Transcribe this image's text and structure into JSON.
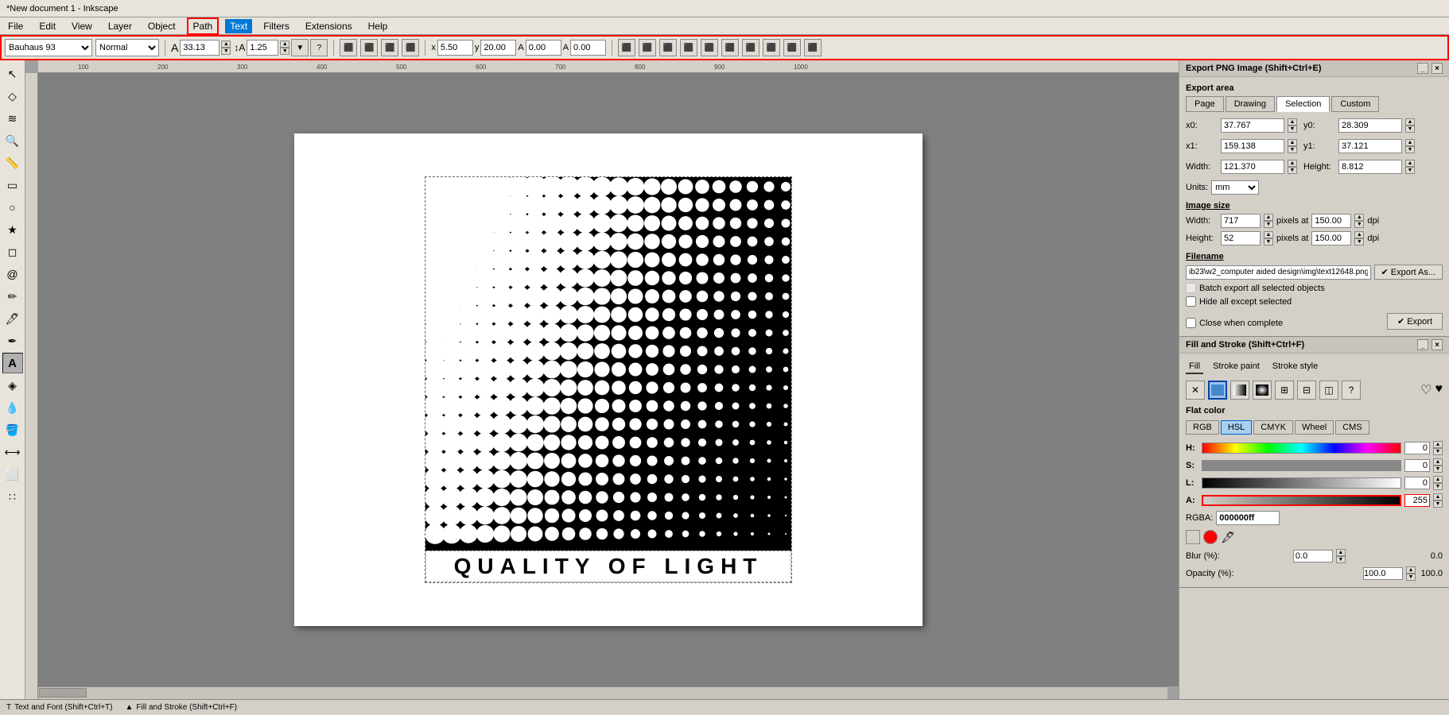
{
  "titlebar": {
    "title": "*New document 1 - Inkscape"
  },
  "menubar": {
    "items": [
      {
        "label": "File",
        "id": "file"
      },
      {
        "label": "Edit",
        "id": "edit"
      },
      {
        "label": "View",
        "id": "view"
      },
      {
        "label": "Layer",
        "id": "layer"
      },
      {
        "label": "Object",
        "id": "object"
      },
      {
        "label": "Path",
        "id": "path",
        "highlighted": true
      },
      {
        "label": "Text",
        "id": "text",
        "active": true
      },
      {
        "label": "Filters",
        "id": "filters"
      },
      {
        "label": "Extensions",
        "id": "extensions"
      },
      {
        "label": "Help",
        "id": "help"
      }
    ]
  },
  "toolbar": {
    "font": "Bauhaus 93",
    "style": "Normal",
    "size": "33.13",
    "height_icon": "A",
    "line_height": "1.25",
    "x": "5.50",
    "y": "20.00",
    "a": "0.00",
    "a2": "0.00",
    "normal_label": "Normal"
  },
  "export_panel": {
    "title": "Export PNG Image (Shift+Ctrl+E)",
    "area_label": "Export area",
    "tabs": [
      "Page",
      "Drawing",
      "Selection",
      "Custom"
    ],
    "active_tab": "Selection",
    "x0_label": "x0:",
    "x0_value": "37.767",
    "y0_label": "y0:",
    "y0_value": "28.309",
    "x1_label": "x1:",
    "x1_value": "159.138",
    "y1_label": "y1:",
    "y1_value": "37.121",
    "width_label": "Width:",
    "width_value": "121.370",
    "height_label": "Height:",
    "height_value": "8.812",
    "units_label": "Units:",
    "units_value": "mm",
    "image_size_title": "Image size",
    "img_width_label": "Width:",
    "img_width_value": "717",
    "pixels_at_label1": "pixels at",
    "dpi_value1": "150.00",
    "dpi_label1": "dpi",
    "img_height_label": "Height:",
    "img_height_value": "52",
    "pixels_at_label2": "pixels at",
    "dpi_value2": "150.00",
    "dpi_label2": "dpi",
    "filename_title": "Filename",
    "filename_value": "ib23\\w2_computer aided design\\img\\text12648.png",
    "export_as_btn": "Export As...",
    "batch_export_label": "Batch export all selected objects",
    "hide_except_label": "Hide all except selected",
    "close_when_label": "Close when complete",
    "export_btn": "Export",
    "custom_label": "Custom"
  },
  "fill_stroke_panel": {
    "title": "Fill and Stroke (Shift+Ctrl+F)",
    "tabs": [
      "Fill",
      "Stroke paint",
      "Stroke style"
    ],
    "active_tab": "Fill",
    "color_types": [
      "X",
      "flat",
      "linear",
      "radial",
      "mesh",
      "pattern",
      "swatch",
      "?"
    ],
    "flat_color_label": "Flat color",
    "color_models": [
      "RGB",
      "HSL",
      "CMYK",
      "Wheel",
      "CMS"
    ],
    "active_model": "HSL",
    "h_label": "H:",
    "h_value": "0",
    "s_label": "S:",
    "s_value": "0",
    "l_label": "L:",
    "l_value": "0",
    "a_label": "A:",
    "a_value": "255",
    "rgba_label": "RGBA:",
    "rgba_value": "000000ff",
    "blur_label": "Blur (%):",
    "blur_value": "0.0",
    "opacity_label": "Opacity (%):",
    "opacity_value": "100.0"
  },
  "bottom_bar": {
    "text_font_label": "Text and Font (Shift+Ctrl+T)",
    "fill_stroke_label": "Fill and Stroke (Shift+Ctrl+F)"
  },
  "canvas": {
    "artwork_text": "QUALITY OF LIGHT"
  }
}
